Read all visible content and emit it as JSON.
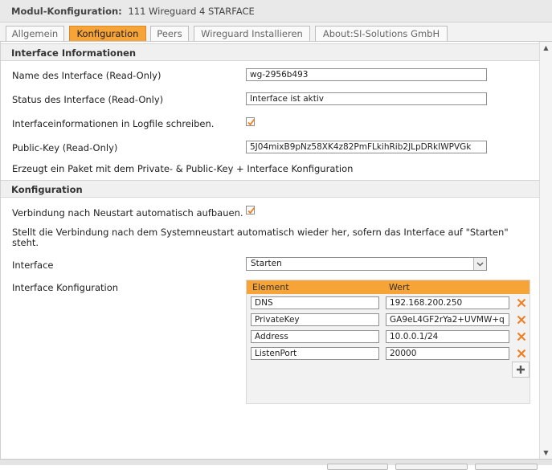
{
  "window": {
    "title_bold": "Modul-Konfiguration:",
    "title_rest": "111 Wireguard 4 STARFACE"
  },
  "tabs": [
    {
      "label": "Allgemein"
    },
    {
      "label": "Konfiguration"
    },
    {
      "label": "Peers"
    },
    {
      "label": "Wireguard Installieren"
    },
    {
      "label": "About:SI-Solutions GmbH"
    }
  ],
  "section_interface": {
    "title": "Interface Informationen",
    "name_label": "Name des Interface (Read-Only)",
    "name_value": "wg-2956b493",
    "status_label": "Status des Interface (Read-Only)",
    "status_value": "Interface ist aktiv",
    "log_label": "Interfaceinformationen in Logfile schreiben.",
    "log_checked": true,
    "pubkey_label": "Public-Key (Read-Only)",
    "pubkey_value": "5J04mixB9pNz58XK4z82PmFLkihRib2JLpDRkIWPVGk",
    "note": "Erzeugt ein Paket mit dem Private- & Public-Key + Interface Konfiguration"
  },
  "section_config": {
    "title": "Konfiguration",
    "autoconnect_label": "Verbindung nach Neustart automatisch aufbauen.",
    "autoconnect_checked": true,
    "description": "Stellt die Verbindung nach dem Systemneustart automatisch wieder her, sofern das Interface auf \"Starten\" steht.",
    "interface_label": "Interface",
    "interface_selected": "Starten",
    "ifconfig_label": "Interface Konfiguration",
    "table": {
      "col_element": "Element",
      "col_wert": "Wert",
      "rows": [
        {
          "element": "DNS",
          "wert": "192.168.200.250"
        },
        {
          "element": "PrivateKey",
          "wert": "GA9eL4GF2rYa2+UVMW+q"
        },
        {
          "element": "Address",
          "wert": "10.0.0.1/24"
        },
        {
          "element": "ListenPort",
          "wert": "20000"
        }
      ]
    }
  },
  "colors": {
    "accent": "#f6a338",
    "delete_icon": "#f07e1e"
  }
}
